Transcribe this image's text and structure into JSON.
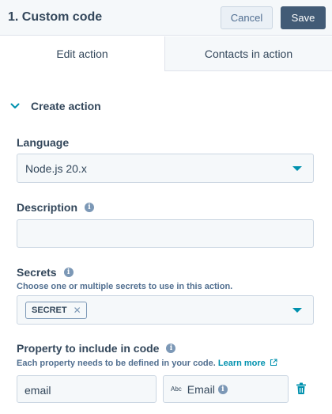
{
  "header": {
    "title": "1. Custom code",
    "cancel_label": "Cancel",
    "save_label": "Save"
  },
  "tabs": [
    {
      "label": "Edit action",
      "active": true
    },
    {
      "label": "Contacts in action",
      "active": false
    }
  ],
  "section": {
    "title": "Create action",
    "expanded": true
  },
  "language": {
    "label": "Language",
    "value": "Node.js 20.x"
  },
  "description": {
    "label": "Description",
    "value": ""
  },
  "secrets": {
    "label": "Secrets",
    "help": "Choose one or multiple secrets to use in this action.",
    "tags": [
      "SECRET"
    ]
  },
  "property": {
    "label": "Property to include in code",
    "help": "Each property needs to be defined in your code.",
    "learn_more": "Learn more",
    "name_value": "email",
    "type_badge": "Abc",
    "selected_property": "Email"
  },
  "colors": {
    "accent": "#0091ae",
    "primary_button": "#425b76",
    "text": "#33475b",
    "field_bg": "#f5f8fa"
  },
  "icons": [
    "info-icon",
    "chevron-down-icon",
    "caret-down-icon",
    "external-link-icon",
    "trash-icon",
    "close-icon"
  ]
}
